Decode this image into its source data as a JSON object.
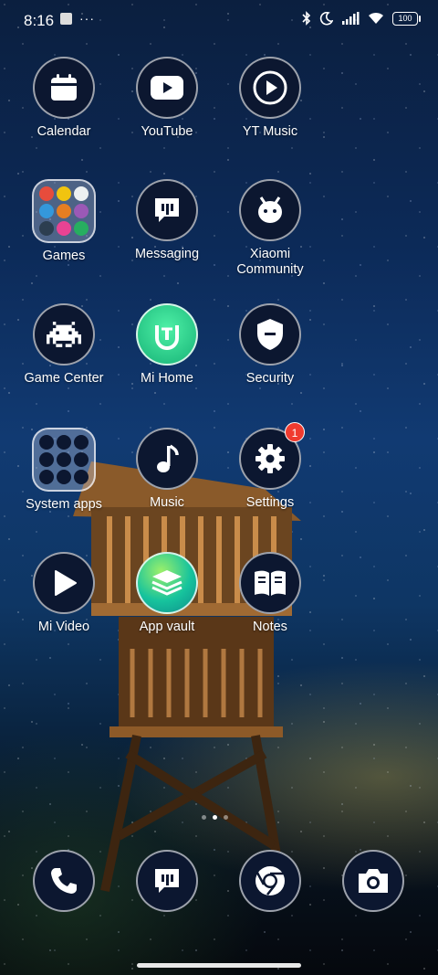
{
  "status_bar": {
    "time": "8:16",
    "battery": "100"
  },
  "apps": [
    {
      "label": "Calendar",
      "icon": "calendar-icon"
    },
    {
      "label": "YouTube",
      "icon": "youtube-icon"
    },
    {
      "label": "YT Music",
      "icon": "yt-music-icon"
    },
    {
      "label": "Games",
      "icon": "games-folder"
    },
    {
      "label": "Messaging",
      "icon": "messaging-icon"
    },
    {
      "label": "Xiaomi\nCommunity",
      "icon": "xiaomi-community-icon"
    },
    {
      "label": "Game Center",
      "icon": "game-center-icon"
    },
    {
      "label": "Mi Home",
      "icon": "mi-home-icon"
    },
    {
      "label": "Security",
      "icon": "security-icon"
    },
    {
      "label": "System apps",
      "icon": "system-apps-folder"
    },
    {
      "label": "Music",
      "icon": "music-icon"
    },
    {
      "label": "Settings",
      "icon": "gear-icon",
      "badge": "1"
    },
    {
      "label": "Mi Video",
      "icon": "play-icon"
    },
    {
      "label": "App vault",
      "icon": "app-vault-icon"
    },
    {
      "label": "Notes",
      "icon": "notes-icon"
    }
  ],
  "dock": [
    {
      "icon": "phone-icon"
    },
    {
      "icon": "messaging-icon"
    },
    {
      "icon": "chrome-icon"
    },
    {
      "icon": "camera-icon"
    }
  ],
  "page_indicator": {
    "pages": 3,
    "active": 1
  }
}
